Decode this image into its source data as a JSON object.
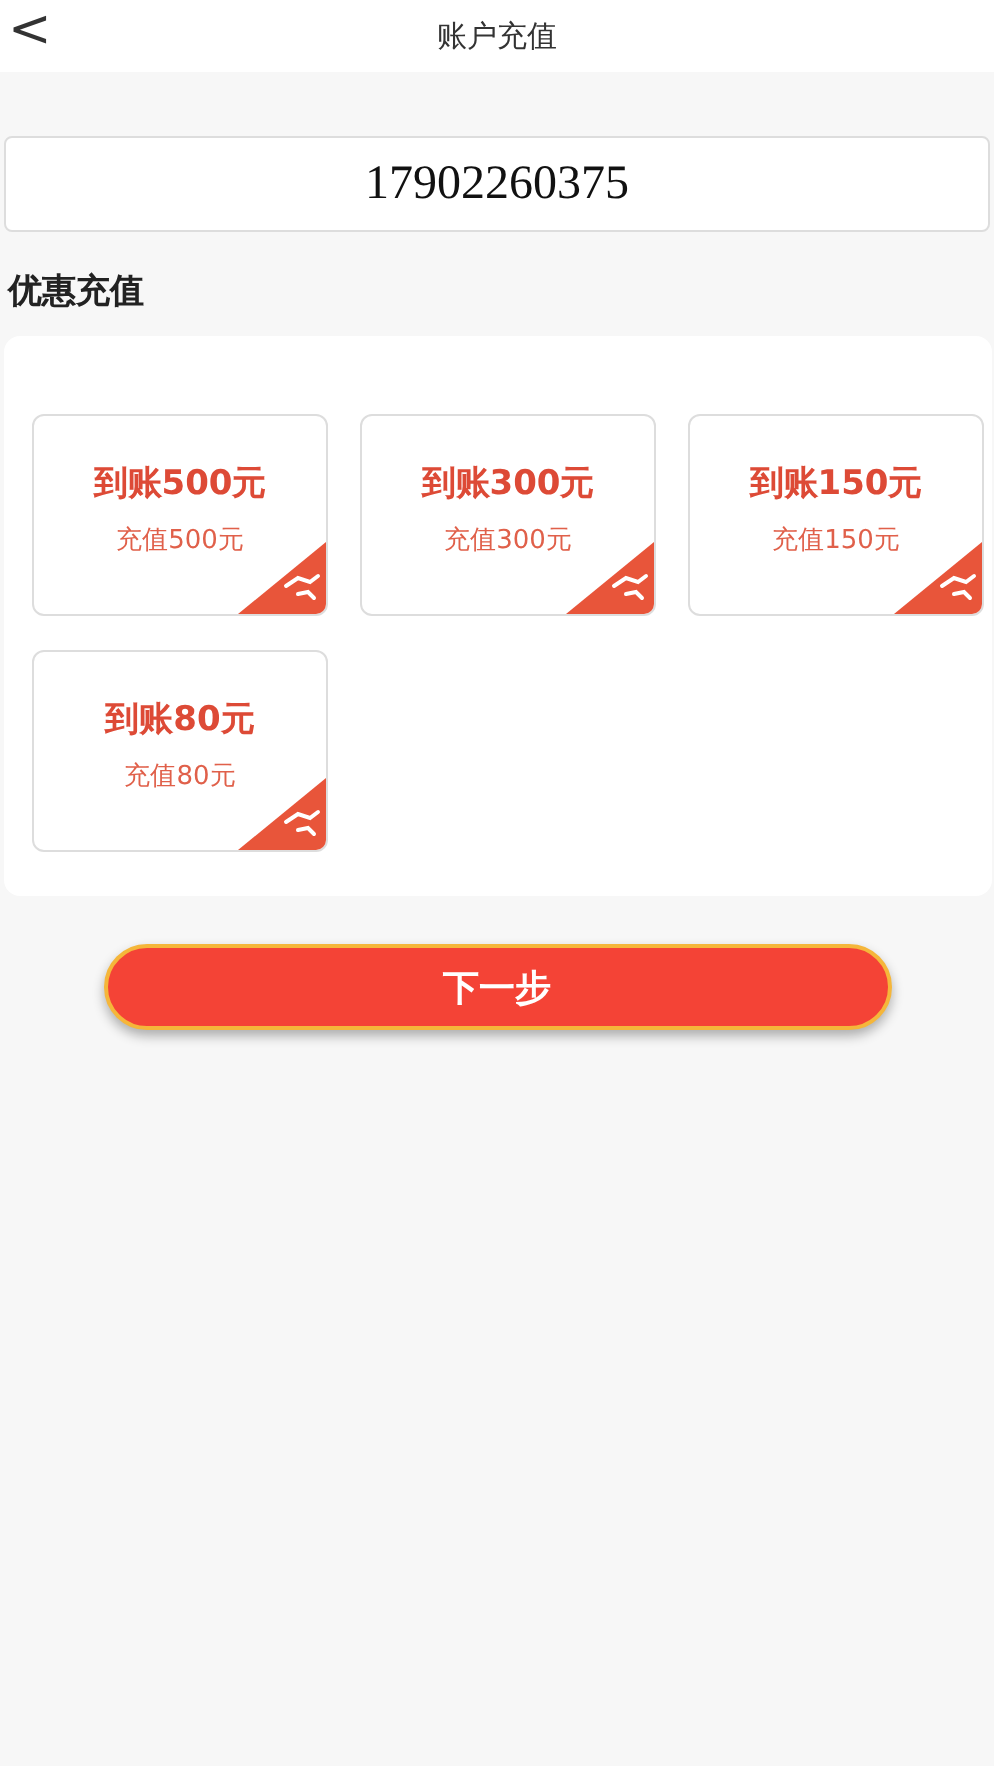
{
  "header": {
    "back": "<",
    "title": "账户充值"
  },
  "account": {
    "value": "17902260375"
  },
  "section_title": "优惠充值",
  "options": [
    {
      "title": "到账500元",
      "subtitle": "充值500元",
      "selected": false
    },
    {
      "title": "到账300元",
      "subtitle": "充值300元",
      "selected": false
    },
    {
      "title": "到账150元",
      "subtitle": "充值150元",
      "selected": false
    },
    {
      "title": "到账80元",
      "subtitle": "充值80元",
      "selected": false
    }
  ],
  "next_button": "下一步"
}
